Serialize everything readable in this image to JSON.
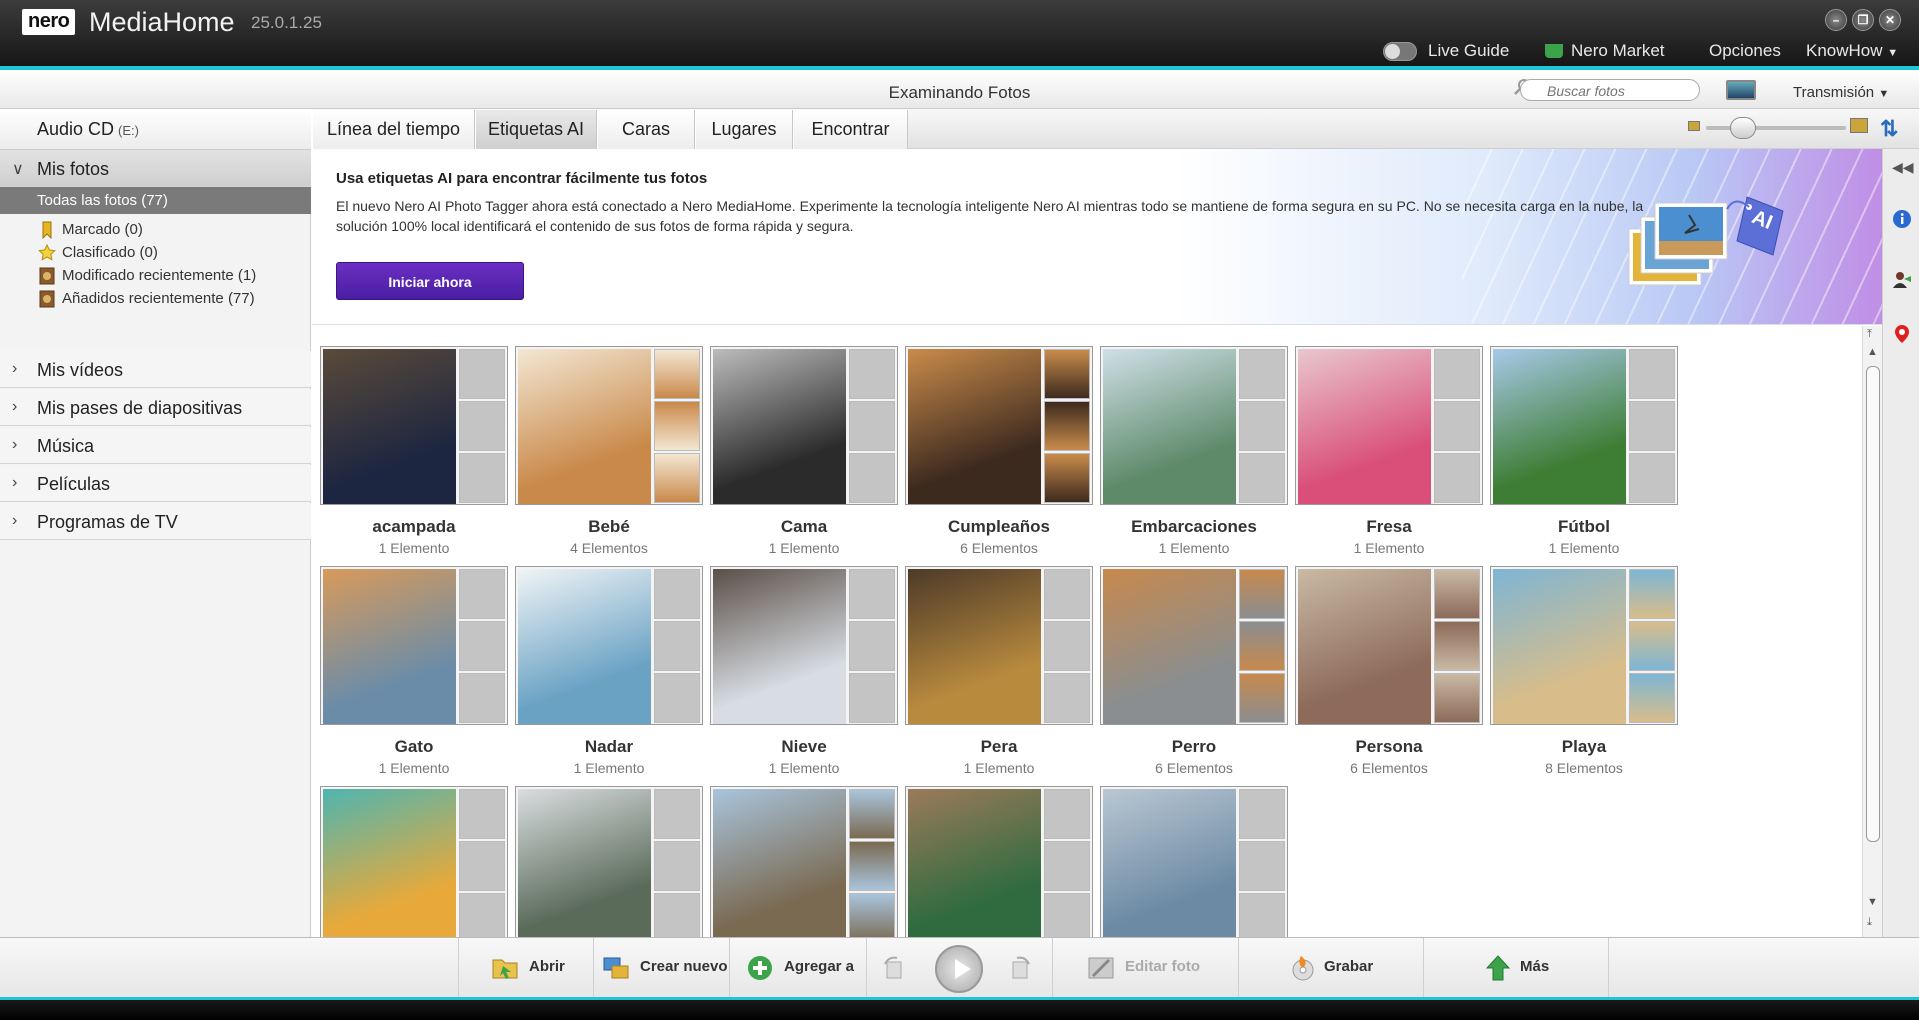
{
  "titlebar": {
    "logo": "nero",
    "app_name": "MediaHome",
    "version": "25.0.1.25",
    "live_guide": "Live Guide",
    "market": "Nero Market",
    "options": "Opciones",
    "knowhow": "KnowHow"
  },
  "subheader": {
    "title": "Examinando Fotos",
    "search_placeholder": "Buscar fotos",
    "transmision": "Transmisión"
  },
  "sidebar": {
    "audio_cd": "Audio CD",
    "audio_cd_drive": "(E:)",
    "mis_fotos": "Mis fotos",
    "all_photos": "Todas las fotos (77)",
    "items": [
      {
        "label": "Marcado (0)",
        "icon": "bookmark-icon"
      },
      {
        "label": "Clasificado (0)",
        "icon": "star-icon"
      },
      {
        "label": "Modificado recientemente (1)",
        "icon": "recent-modified-icon"
      },
      {
        "label": "Añadidos recientemente (77)",
        "icon": "recent-added-icon"
      }
    ],
    "categories": [
      "Mis vídeos",
      "Mis pases de diapositivas",
      "Música",
      "Películas",
      "Programas de TV"
    ]
  },
  "tabs": [
    "Línea del tiempo",
    "Etiquetas AI",
    "Caras",
    "Lugares",
    "Encontrar"
  ],
  "banner": {
    "title": "Usa etiquetas AI para encontrar fácilmente tus fotos",
    "text": "El nuevo Nero AI Photo Tagger ahora está conectado a Nero MediaHome. Experimente la tecnología inteligente Nero AI mientras todo se mantiene de forma segura en su PC. No se necesita carga en la nube, la solución 100% local identificará el contenido de sus fotos de forma rápida y segura.",
    "button": "Iniciar ahora",
    "tag_label": "AI"
  },
  "albums": [
    {
      "name": "acampada",
      "count": "1 Elemento",
      "color": "#1d2640",
      "color2": "#5a4a3a",
      "thumbs": 0
    },
    {
      "name": "Bebé",
      "count": "4 Elementos",
      "color": "#c9894a",
      "color2": "#f3e7d3",
      "thumbs": 3
    },
    {
      "name": "Cama",
      "count": "1 Elemento",
      "color": "#2b2b2b",
      "color2": "#bcbcbc",
      "thumbs": 0
    },
    {
      "name": "Cumpleaños",
      "count": "6 Elementos",
      "color": "#3d2a1f",
      "color2": "#c98b4a",
      "thumbs": 3
    },
    {
      "name": "Embarcaciones",
      "count": "1 Elemento",
      "color": "#5e8a6a",
      "color2": "#cfe0e8",
      "thumbs": 0
    },
    {
      "name": "Fresa",
      "count": "1 Elemento",
      "color": "#d94f7a",
      "color2": "#e9c7cf",
      "thumbs": 0
    },
    {
      "name": "Fútbol",
      "count": "1 Elemento",
      "color": "#3e7d34",
      "color2": "#a7c9e8",
      "thumbs": 0
    },
    {
      "name": "Gato",
      "count": "1 Elemento",
      "color": "#6b8ca8",
      "color2": "#d89a5a",
      "thumbs": 0
    },
    {
      "name": "Nadar",
      "count": "1 Elemento",
      "color": "#6aa2c4",
      "color2": "#f0f4f6",
      "thumbs": 0
    },
    {
      "name": "Nieve",
      "count": "1 Elemento",
      "color": "#d8dde3",
      "color2": "#5a4f48",
      "thumbs": 0
    },
    {
      "name": "Pera",
      "count": "1 Elemento",
      "color": "#b88a3e",
      "color2": "#4d3a28",
      "thumbs": 0
    },
    {
      "name": "Perro",
      "count": "6 Elementos",
      "color": "#8a8e90",
      "color2": "#c7894d",
      "thumbs": 3
    },
    {
      "name": "Persona",
      "count": "6 Elementos",
      "color": "#8d6a5a",
      "color2": "#c9b9a5",
      "thumbs": 3
    },
    {
      "name": "Playa",
      "count": "8 Elementos",
      "color": "#d8bd8a",
      "color2": "#7eb5d4",
      "thumbs": 3
    },
    {
      "name": "",
      "count": "",
      "color": "#e7a93a",
      "color2": "#4fb5b0",
      "thumbs": 0
    },
    {
      "name": "",
      "count": "",
      "color": "#5b6b5a",
      "color2": "#d9dee0",
      "thumbs": 0
    },
    {
      "name": "",
      "count": "",
      "color": "#7a6a52",
      "color2": "#a9c4dc",
      "thumbs": 3
    },
    {
      "name": "",
      "count": "",
      "color": "#2f6b3f",
      "color2": "#9b7a5a",
      "thumbs": 0
    },
    {
      "name": "",
      "count": "",
      "color": "#6c8aa4",
      "color2": "#b9c7d2",
      "thumbs": 0
    }
  ],
  "bottom": {
    "open": "Abrir",
    "create_new": "Crear nuevo",
    "add_to": "Agregar a",
    "edit_photo": "Editar foto",
    "burn": "Grabar",
    "more": "Más"
  },
  "colors": {
    "accent": "#1ec5d4",
    "primary_button": "#5a24b3"
  }
}
